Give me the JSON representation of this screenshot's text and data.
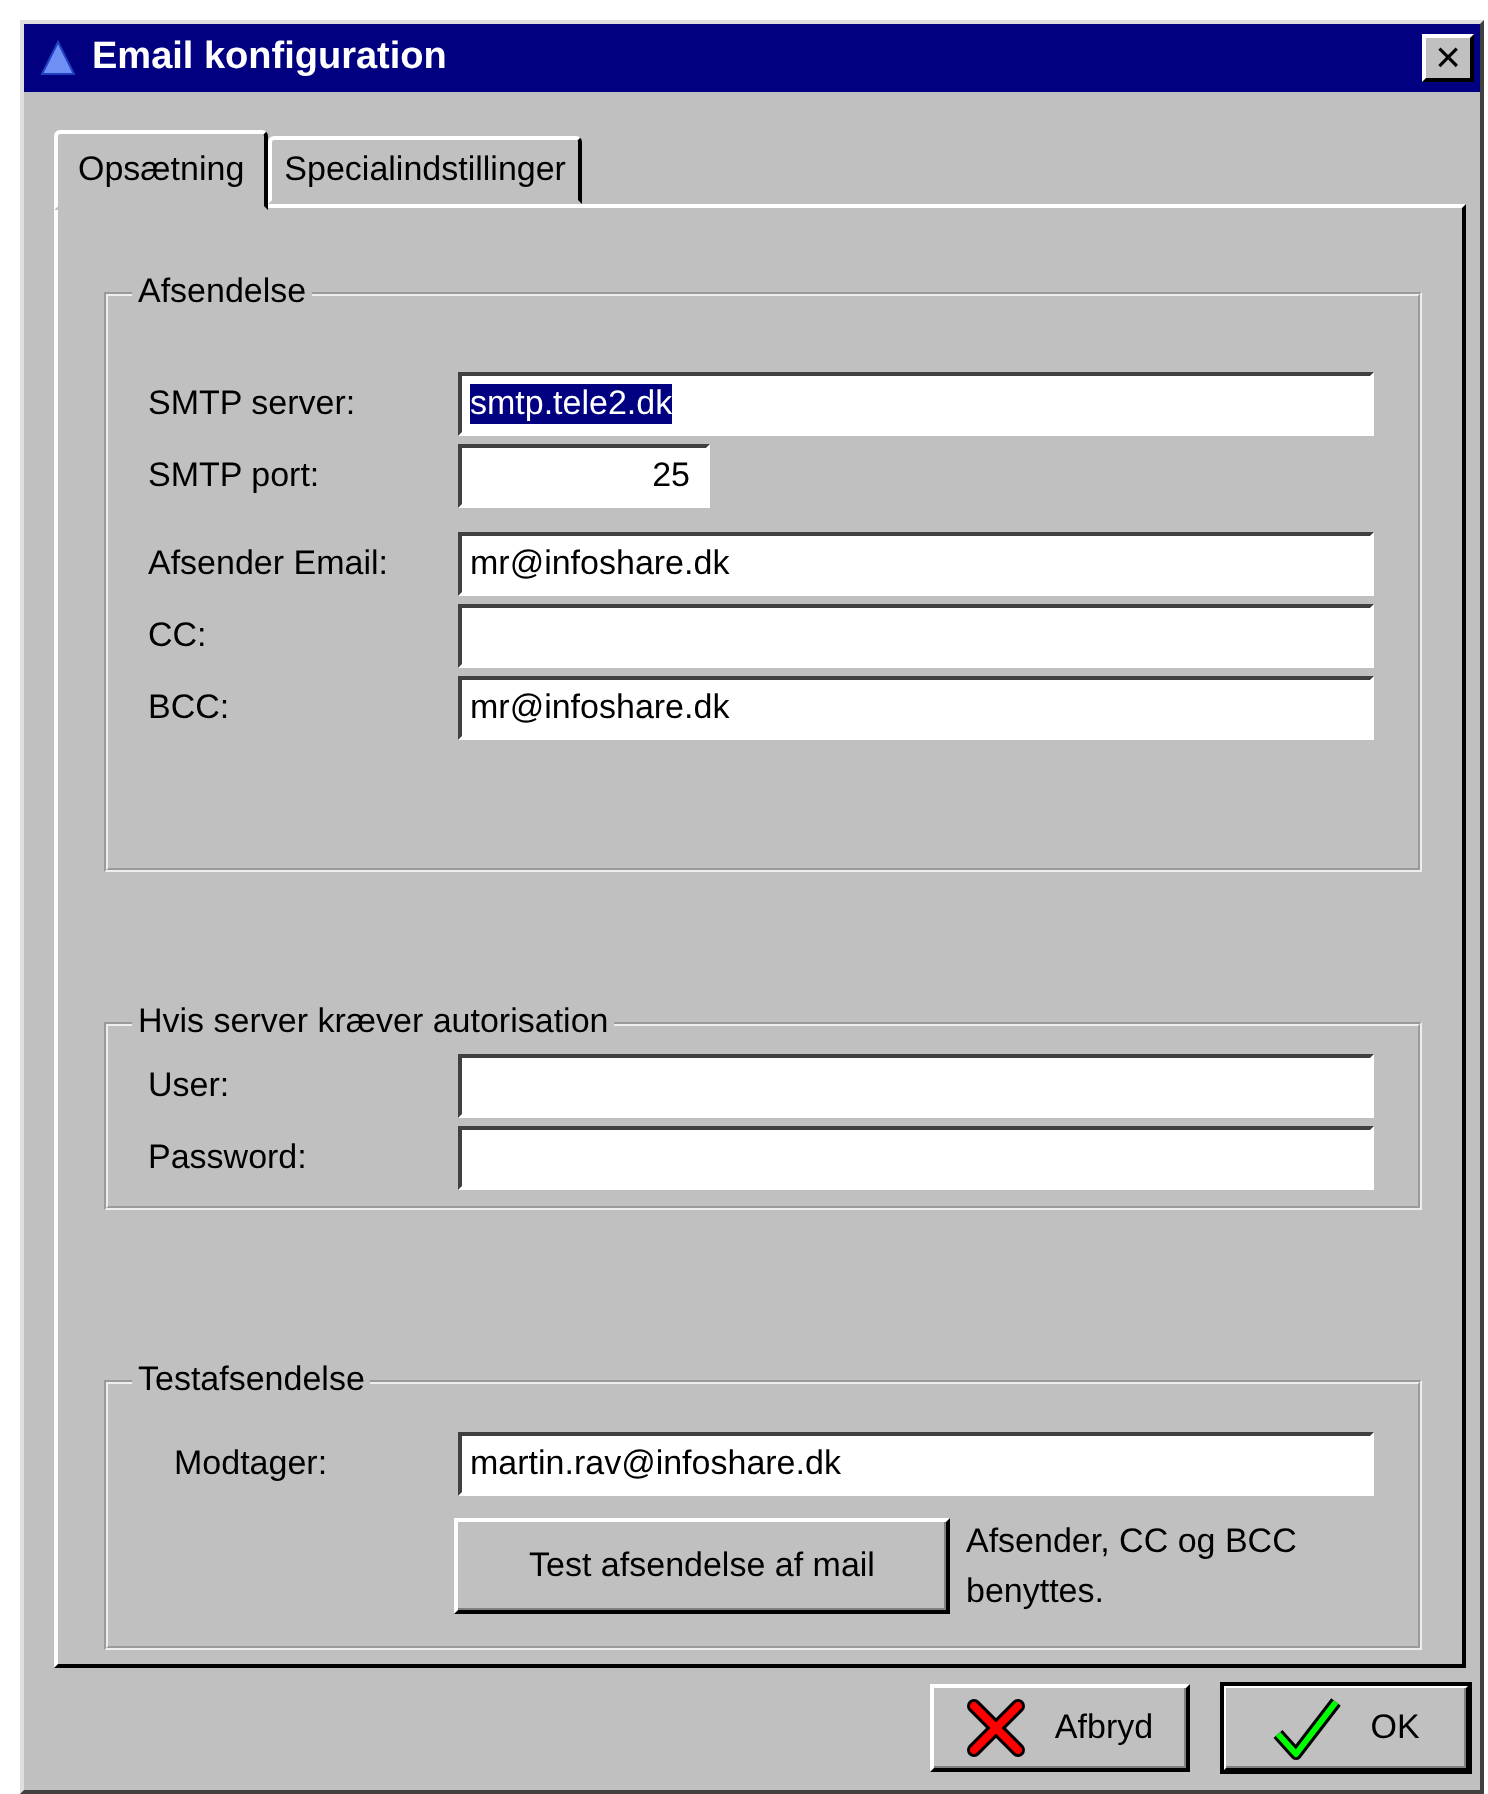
{
  "window": {
    "title": "Email konfiguration",
    "close": "×"
  },
  "tabs": [
    {
      "label": "Opsætning",
      "selected": true
    },
    {
      "label": "Specialindstillinger",
      "selected": false
    }
  ],
  "groups": [
    {
      "title": "Afsendelse",
      "fields": [
        {
          "label": "SMTP server:",
          "value": "smtp.tele2.dk",
          "kind": "wide",
          "highlighted": true
        },
        {
          "label": "SMTP port:",
          "value": "25",
          "kind": "number",
          "highlighted": false
        },
        {
          "label": "Afsender Email:",
          "value": "mr@infoshare.dk",
          "kind": "wide",
          "highlighted": false
        },
        {
          "label": "CC:",
          "kind": "wide"
        },
        {
          "label": "BCC:",
          "value": "mr@infoshare.dk",
          "kind": "wide",
          "highlighted": false
        }
      ]
    },
    {
      "title": "Hvis server kræver autorisation",
      "fields": [
        {
          "label": "User:",
          "kind": "wide"
        },
        {
          "label": "Password:",
          "kind": "wide"
        }
      ]
    },
    {
      "title": "Testafsendelse",
      "fields": [
        {
          "label": "Modtager:",
          "value": "martin.rav@infoshare.dk",
          "kind": "wide",
          "highlighted": false
        }
      ],
      "action": {
        "label": "Test afsendelse af mail",
        "note": "Afsender, CC og BCC benyttes."
      }
    }
  ],
  "buttons": [
    {
      "label": "Afbryd",
      "kind": "cancel"
    },
    {
      "label": "OK",
      "kind": "ok"
    }
  ]
}
